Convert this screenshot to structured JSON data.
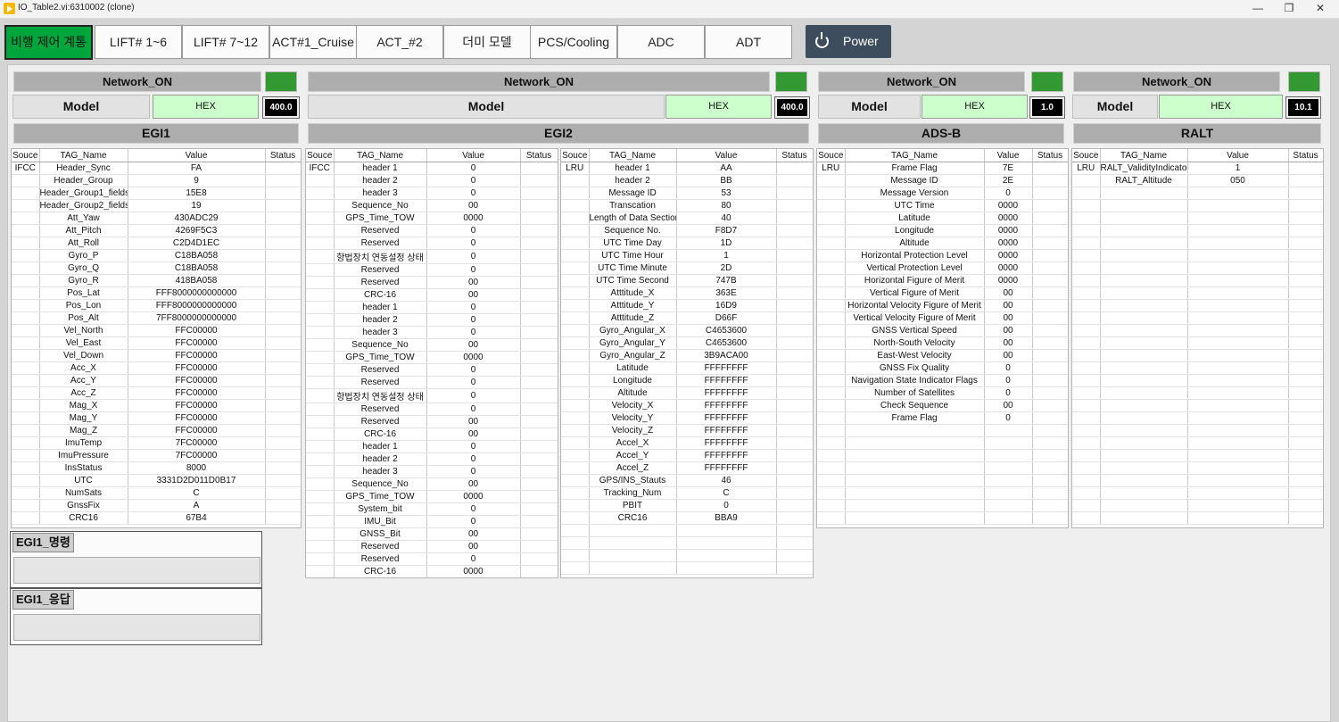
{
  "window": {
    "title": "IO_Table2.vi:6310002 (clone)",
    "minimize": "—",
    "maximize": "❐",
    "close": "✕"
  },
  "tabs": [
    "비행 제어 계통",
    "LIFT# 1~6",
    "LIFT# 7~12",
    "ACT#1_Cruise",
    "ACT_#2",
    "더미 모델",
    "PCS/Cooling",
    "ADC",
    "ADT"
  ],
  "power_label": "Power",
  "columns": [
    "Souce",
    "TAG_Name",
    "Value",
    "Status"
  ],
  "panels": [
    {
      "network": "Network_ON",
      "model_label": "Model",
      "mode": "HEX",
      "rate": "400.0",
      "name": "EGI1",
      "rows": [
        [
          "IFCC",
          "Header_Sync",
          "FA",
          ""
        ],
        [
          "",
          "Header_Group",
          "9",
          ""
        ],
        [
          "",
          "Header_Group1_fields",
          "15E8",
          ""
        ],
        [
          "",
          "Header_Group2_fields",
          "19",
          ""
        ],
        [
          "",
          "Att_Yaw",
          "430ADC29",
          ""
        ],
        [
          "",
          "Att_Pitch",
          "4269F5C3",
          ""
        ],
        [
          "",
          "Att_Roll",
          "C2D4D1EC",
          ""
        ],
        [
          "",
          "Gyro_P",
          "C18BA058",
          ""
        ],
        [
          "",
          "Gyro_Q",
          "C18BA058",
          ""
        ],
        [
          "",
          "Gyro_R",
          "418BA058",
          ""
        ],
        [
          "",
          "Pos_Lat",
          "FFF8000000000000",
          ""
        ],
        [
          "",
          "Pos_Lon",
          "FFF8000000000000",
          ""
        ],
        [
          "",
          "Pos_Alt",
          "7FF8000000000000",
          ""
        ],
        [
          "",
          "Vel_North",
          "FFC00000",
          ""
        ],
        [
          "",
          "Vel_East",
          "FFC00000",
          ""
        ],
        [
          "",
          "Vel_Down",
          "FFC00000",
          ""
        ],
        [
          "",
          "Acc_X",
          "FFC00000",
          ""
        ],
        [
          "",
          "Acc_Y",
          "FFC00000",
          ""
        ],
        [
          "",
          "Acc_Z",
          "FFC00000",
          ""
        ],
        [
          "",
          "Mag_X",
          "FFC00000",
          ""
        ],
        [
          "",
          "Mag_Y",
          "FFC00000",
          ""
        ],
        [
          "",
          "Mag_Z",
          "FFC00000",
          ""
        ],
        [
          "",
          "ImuTemp",
          "7FC00000",
          ""
        ],
        [
          "",
          "ImuPressure",
          "7FC00000",
          ""
        ],
        [
          "",
          "InsStatus",
          "8000",
          ""
        ],
        [
          "",
          "UTC",
          "3331D2D011D0B17",
          ""
        ],
        [
          "",
          "NumSats",
          "C",
          ""
        ],
        [
          "",
          "GnssFix",
          "A",
          ""
        ],
        [
          "",
          "CRC16",
          "67B4",
          ""
        ]
      ],
      "command_label": "EGI1_명령",
      "response_label": "EGI1_응답"
    },
    {
      "network": "Network_ON",
      "model_label": "Model",
      "mode": "HEX",
      "rate": "400.0",
      "name": "EGI2",
      "rows_left": [
        [
          "IFCC",
          "header 1",
          "0",
          ""
        ],
        [
          "",
          "header 2",
          "0",
          ""
        ],
        [
          "",
          "header 3",
          "0",
          ""
        ],
        [
          "",
          "Sequence_No",
          "00",
          ""
        ],
        [
          "",
          "GPS_Time_TOW",
          "0000",
          ""
        ],
        [
          "",
          "Reserved",
          "0",
          ""
        ],
        [
          "",
          "Reserved",
          "0",
          ""
        ],
        [
          "",
          "항법장치 연동설정 상태",
          "0",
          ""
        ],
        [
          "",
          "Reserved",
          "0",
          ""
        ],
        [
          "",
          "Reserved",
          "00",
          ""
        ],
        [
          "",
          "CRC-16",
          "00",
          ""
        ],
        [
          "",
          "header 1",
          "0",
          ""
        ],
        [
          "",
          "header 2",
          "0",
          ""
        ],
        [
          "",
          "header 3",
          "0",
          ""
        ],
        [
          "",
          "Sequence_No",
          "00",
          ""
        ],
        [
          "",
          "GPS_Time_TOW",
          "0000",
          ""
        ],
        [
          "",
          "Reserved",
          "0",
          ""
        ],
        [
          "",
          "Reserved",
          "0",
          ""
        ],
        [
          "",
          "항법장치 연동설정 상태",
          "0",
          ""
        ],
        [
          "",
          "Reserved",
          "0",
          ""
        ],
        [
          "",
          "Reserved",
          "00",
          ""
        ],
        [
          "",
          "CRC-16",
          "00",
          ""
        ],
        [
          "",
          "header 1",
          "0",
          ""
        ],
        [
          "",
          "header 2",
          "0",
          ""
        ],
        [
          "",
          "header 3",
          "0",
          ""
        ],
        [
          "",
          "Sequence_No",
          "00",
          ""
        ],
        [
          "",
          "GPS_Time_TOW",
          "0000",
          ""
        ],
        [
          "",
          "System_bit",
          "0",
          ""
        ],
        [
          "",
          "IMU_Bit",
          "0",
          ""
        ],
        [
          "",
          "GNSS_Bit",
          "00",
          ""
        ],
        [
          "",
          "Reserved",
          "00",
          ""
        ],
        [
          "",
          "Reserved",
          "0",
          ""
        ],
        [
          "",
          "CRC-16",
          "0000",
          ""
        ]
      ],
      "rows_right": [
        [
          "LRU",
          "header 1",
          "AA",
          ""
        ],
        [
          "",
          "header 2",
          "BB",
          ""
        ],
        [
          "",
          "Message ID",
          "53",
          ""
        ],
        [
          "",
          "Transcation",
          "80",
          ""
        ],
        [
          "",
          "Length of Data Section",
          "40",
          ""
        ],
        [
          "",
          "Sequence No.",
          "F8D7",
          ""
        ],
        [
          "",
          "UTC Time Day",
          "1D",
          ""
        ],
        [
          "",
          "UTC Time Hour",
          "1",
          ""
        ],
        [
          "",
          "UTC Time Minute",
          "2D",
          ""
        ],
        [
          "",
          "UTC Time Second",
          "747B",
          ""
        ],
        [
          "",
          "Atttitude_X",
          "363E",
          ""
        ],
        [
          "",
          "Atttitude_Y",
          "16D9",
          ""
        ],
        [
          "",
          "Atttitude_Z",
          "D66F",
          ""
        ],
        [
          "",
          "Gyro_Angular_X",
          "C4653600",
          ""
        ],
        [
          "",
          "Gyro_Angular_Y",
          "C4653600",
          ""
        ],
        [
          "",
          "Gyro_Angular_Z",
          "3B9ACA00",
          ""
        ],
        [
          "",
          "Latitude",
          "FFFFFFFF",
          ""
        ],
        [
          "",
          "Longitude",
          "FFFFFFFF",
          ""
        ],
        [
          "",
          "Altitude",
          "FFFFFFFF",
          ""
        ],
        [
          "",
          "Velocity_X",
          "FFFFFFFF",
          ""
        ],
        [
          "",
          "Velocity_Y",
          "FFFFFFFF",
          ""
        ],
        [
          "",
          "Velocity_Z",
          "FFFFFFFF",
          ""
        ],
        [
          "",
          "Accel_X",
          "FFFFFFFF",
          ""
        ],
        [
          "",
          "Accel_Y",
          "FFFFFFFF",
          ""
        ],
        [
          "",
          "Accel_Z",
          "FFFFFFFF",
          ""
        ],
        [
          "",
          "GPS/INS_Stauts",
          "46",
          ""
        ],
        [
          "",
          "Tracking_Num",
          "C",
          ""
        ],
        [
          "",
          "PBIT",
          "0",
          ""
        ],
        [
          "",
          "CRC16",
          "BBA9",
          ""
        ]
      ]
    },
    {
      "network": "Network_ON",
      "model_label": "Model",
      "mode": "HEX",
      "rate": "1.0",
      "name": "ADS-B",
      "rows": [
        [
          "LRU",
          "Frame Flag",
          "7E",
          ""
        ],
        [
          "",
          "Message ID",
          "2E",
          ""
        ],
        [
          "",
          "Message Version",
          "0",
          ""
        ],
        [
          "",
          "UTC Time",
          "0000",
          ""
        ],
        [
          "",
          "Latitude",
          "0000",
          ""
        ],
        [
          "",
          "Longitude",
          "0000",
          ""
        ],
        [
          "",
          "Altitude",
          "0000",
          ""
        ],
        [
          "",
          "Horizontal Protection Level",
          "0000",
          ""
        ],
        [
          "",
          "Vertical Protection Level",
          "0000",
          ""
        ],
        [
          "",
          "Horizontal Figure of Merit",
          "0000",
          ""
        ],
        [
          "",
          "Vertical Figure of Merit",
          "00",
          ""
        ],
        [
          "",
          "Horizontal Velocity Figure of Merit",
          "00",
          ""
        ],
        [
          "",
          "Vertical Velocity Figure of Merit",
          "00",
          ""
        ],
        [
          "",
          "GNSS Vertical Speed",
          "00",
          ""
        ],
        [
          "",
          "North-South Velocity",
          "00",
          ""
        ],
        [
          "",
          "East-West Velocity",
          "00",
          ""
        ],
        [
          "",
          "GNSS Fix Quality",
          "0",
          ""
        ],
        [
          "",
          "Navigation State Indicator Flags",
          "0",
          ""
        ],
        [
          "",
          "Number of Satellites",
          "0",
          ""
        ],
        [
          "",
          "Check Sequence",
          "00",
          ""
        ],
        [
          "",
          "Frame Flag",
          "0",
          ""
        ]
      ]
    },
    {
      "network": "Network_ON",
      "model_label": "Model",
      "mode": "HEX",
      "rate": "10.1",
      "name": "RALT",
      "rows": [
        [
          "LRU",
          "RALT_ValidityIndicator",
          "1",
          ""
        ],
        [
          "",
          "RALT_Altitude",
          "050",
          ""
        ]
      ]
    }
  ]
}
